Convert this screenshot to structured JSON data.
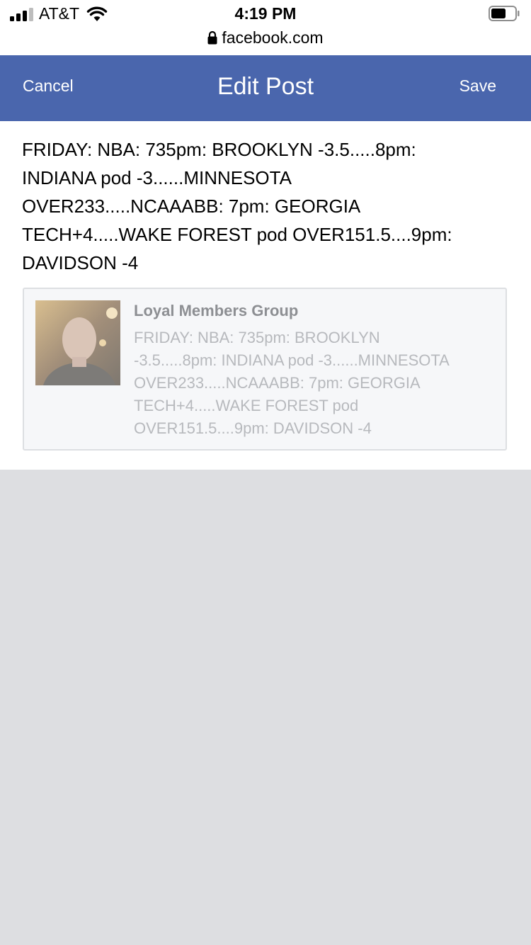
{
  "status_bar": {
    "carrier": "AT&T",
    "time": "4:19 PM",
    "url": "facebook.com",
    "signal_bars": 3,
    "battery_level": 0.6
  },
  "navbar": {
    "cancel_label": "Cancel",
    "title": "Edit Post",
    "save_label": "Save",
    "background_color": "#4a66ad"
  },
  "post": {
    "lines": [
      "FRIDAY: NBA: 735pm: BROOKLYN -3.5.....8pm:",
      "INDIANA pod -3......MINNESOTA",
      "OVER233.....NCAAABB: 7pm: GEORGIA",
      "TECH+4.....WAKE FOREST pod OVER151.5....9pm:",
      "DAVIDSON -4"
    ]
  },
  "shared_card": {
    "title": "Loyal Members Group",
    "lines": [
      "FRIDAY: NBA: 735pm: BROOKLYN",
      "-3.5.....8pm: INDIANA pod -3......MINNESOTA",
      "OVER233.....NCAAABB: 7pm: GEORGIA",
      "TECH+4.....WAKE FOREST pod",
      "OVER151.5....9pm: DAVIDSON -4"
    ]
  }
}
